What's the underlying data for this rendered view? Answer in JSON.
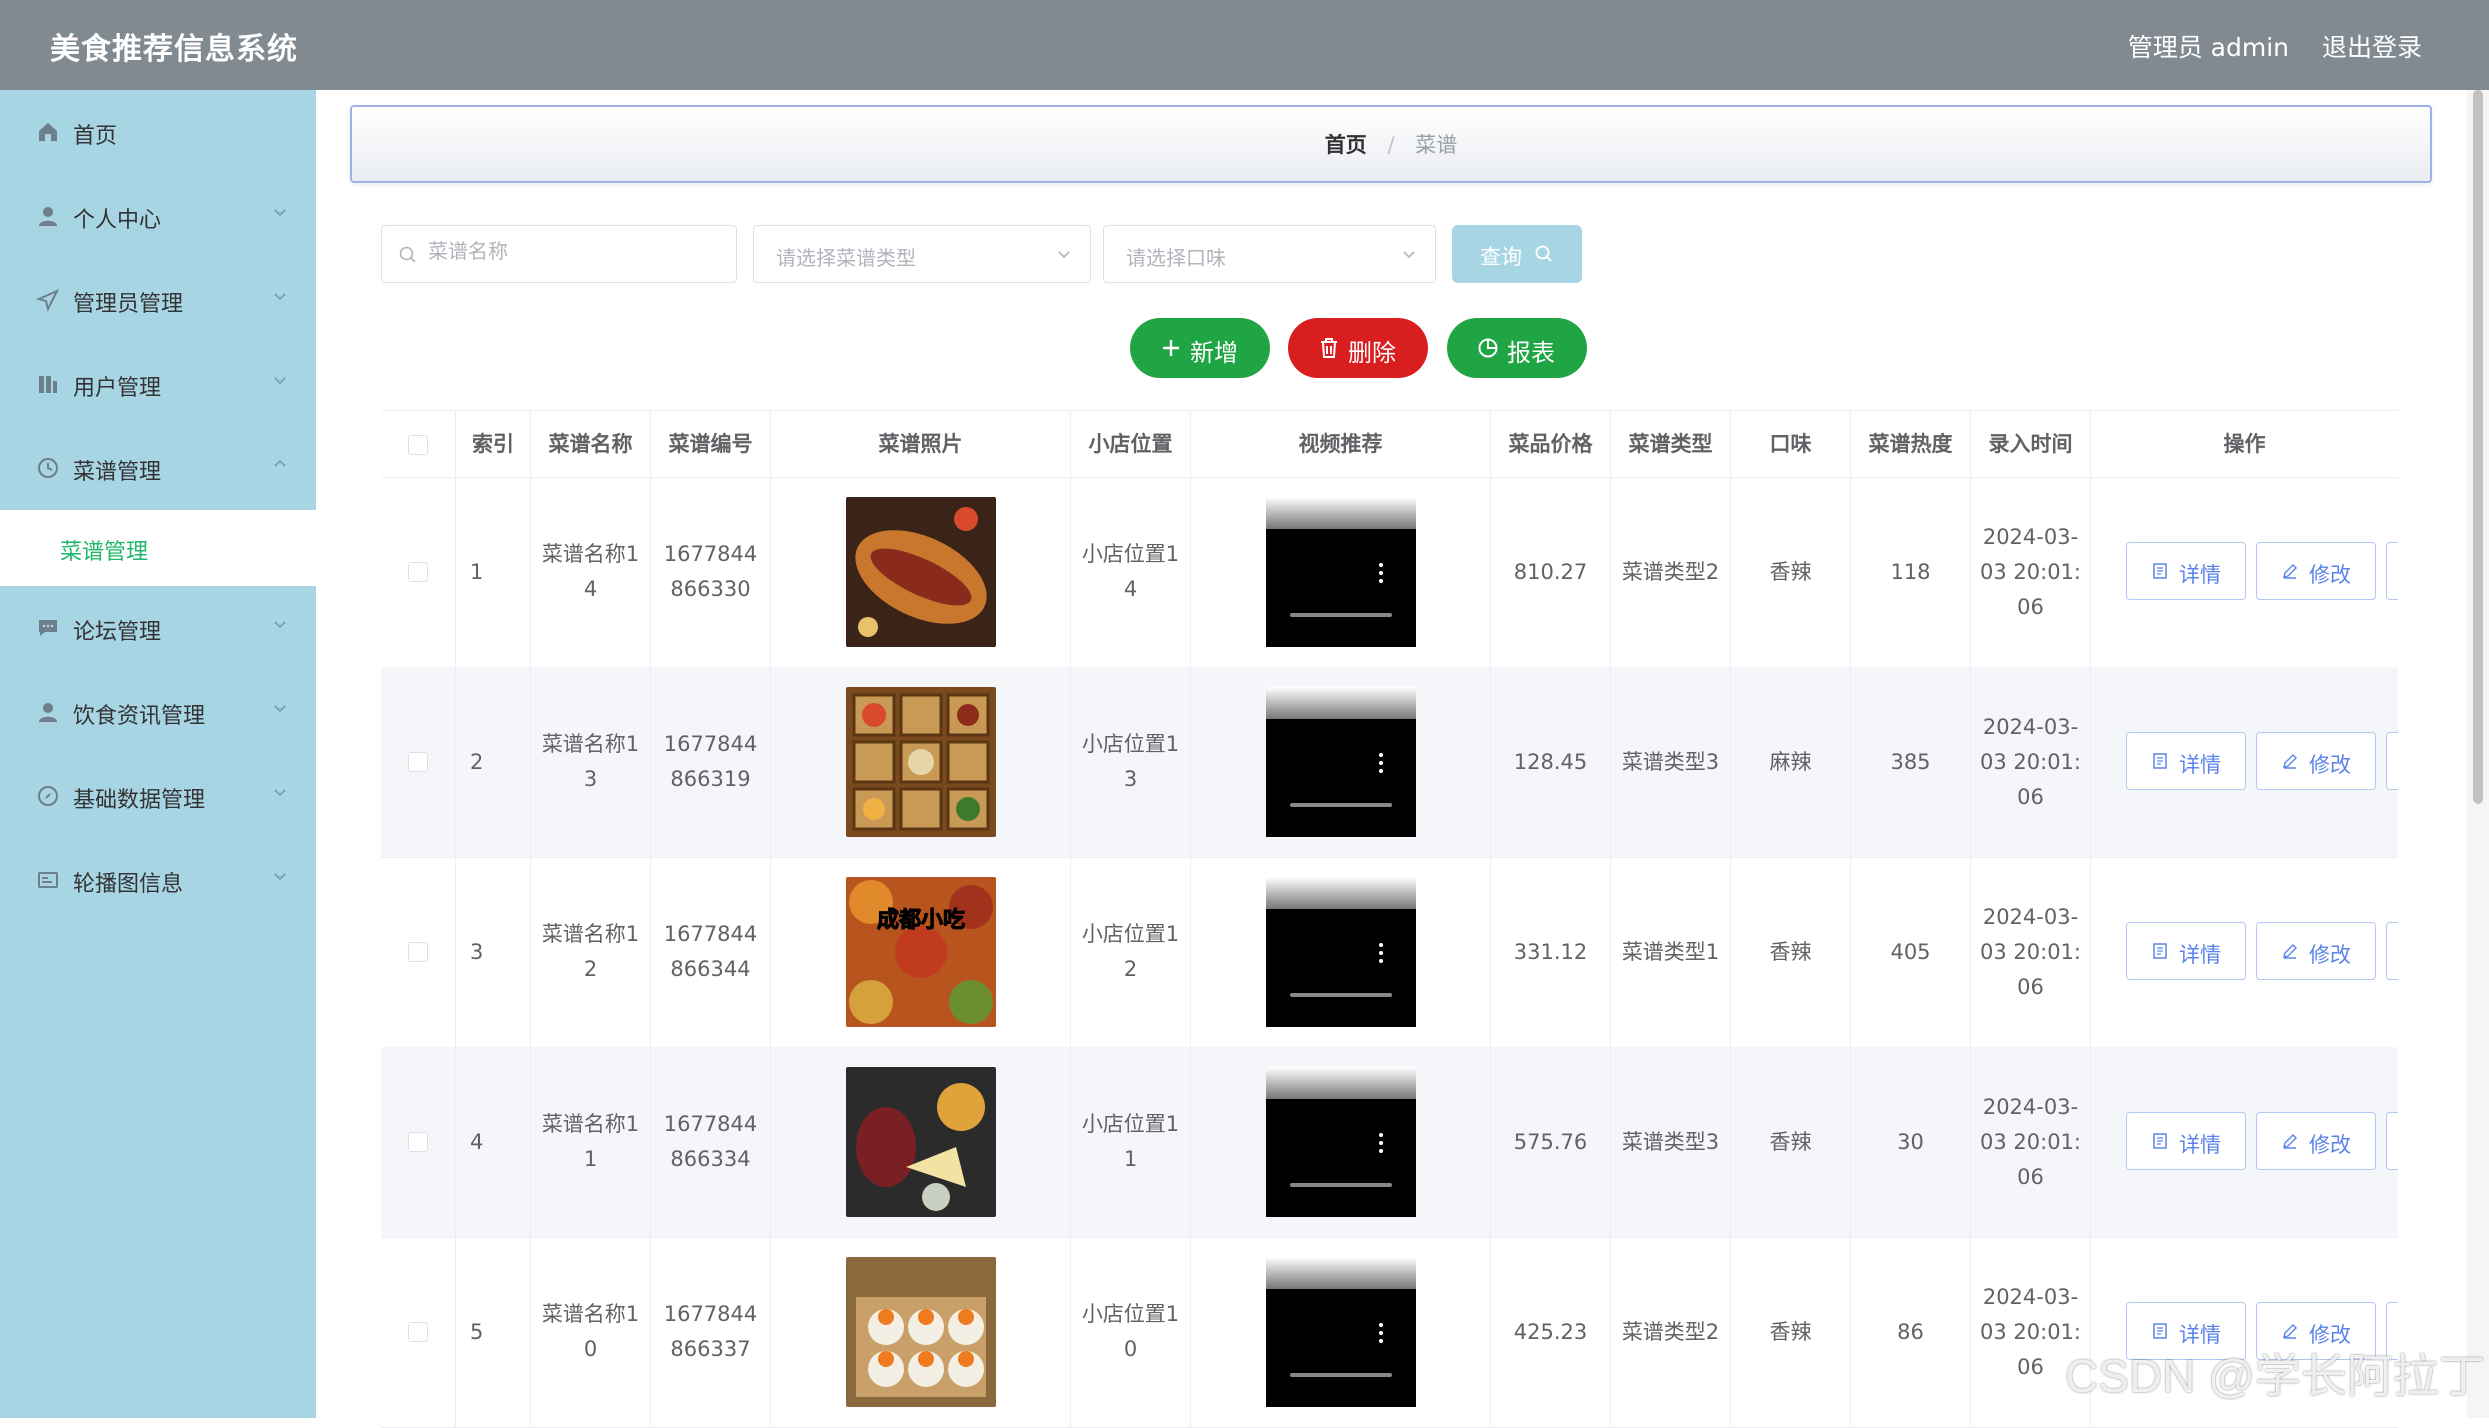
{
  "header": {
    "title": "美食推荐信息系统",
    "user": "管理员 admin",
    "logout": "退出登录"
  },
  "sidebar": {
    "items": [
      {
        "label": "首页",
        "icon": "home-icon"
      },
      {
        "label": "个人中心",
        "icon": "user-icon"
      },
      {
        "label": "管理员管理",
        "icon": "send-icon"
      },
      {
        "label": "用户管理",
        "icon": "chart-icon"
      },
      {
        "label": "菜谱管理",
        "icon": "clock-icon"
      },
      {
        "label": "论坛管理",
        "icon": "chat-icon"
      },
      {
        "label": "饮食资讯管理",
        "icon": "user-icon"
      },
      {
        "label": "基础数据管理",
        "icon": "compass-icon"
      },
      {
        "label": "轮播图信息",
        "icon": "card-icon"
      }
    ],
    "submenu": {
      "label": "菜谱管理"
    }
  },
  "breadcrumb": {
    "home": "首页",
    "separator": "/",
    "current": "菜谱"
  },
  "search": {
    "name_placeholder": "菜谱名称",
    "type_placeholder": "请选择菜谱类型",
    "taste_placeholder": "请选择口味",
    "query_label": "查询"
  },
  "actions": {
    "add": "新增",
    "delete": "删除",
    "report": "报表"
  },
  "colors": {
    "header": "#808a90",
    "sidebar": "#a8d5e4",
    "add": "#1fa543",
    "delete": "#d81e1e",
    "report": "#1fa543",
    "active_sub": "#1fb86a"
  },
  "table": {
    "headers": [
      "索引",
      "菜谱名称",
      "菜谱编号",
      "菜谱照片",
      "小店位置",
      "视频推荐",
      "菜品价格",
      "菜谱类型",
      "口味",
      "菜谱热度",
      "录入时间",
      "操作"
    ],
    "detail_label": "详情",
    "edit_label": "修改",
    "rows": [
      {
        "index": "1",
        "name": "菜谱名称14",
        "code": "1677844866330",
        "location": "小店位置14",
        "price": "810.27",
        "type": "菜谱类型2",
        "taste": "香辣",
        "heat": "118",
        "time": "2024-03-03 20:01:06"
      },
      {
        "index": "2",
        "name": "菜谱名称13",
        "code": "1677844866319",
        "location": "小店位置13",
        "price": "128.45",
        "type": "菜谱类型3",
        "taste": "麻辣",
        "heat": "385",
        "time": "2024-03-03 20:01:06"
      },
      {
        "index": "3",
        "name": "菜谱名称12",
        "code": "1677844866344",
        "location": "小店位置12",
        "price": "331.12",
        "type": "菜谱类型1",
        "taste": "香辣",
        "heat": "405",
        "time": "2024-03-03 20:01:06"
      },
      {
        "index": "4",
        "name": "菜谱名称11",
        "code": "1677844866334",
        "location": "小店位置11",
        "price": "575.76",
        "type": "菜谱类型3",
        "taste": "香辣",
        "heat": "30",
        "time": "2024-03-03 20:01:06"
      },
      {
        "index": "5",
        "name": "菜谱名称10",
        "code": "1677844866337",
        "location": "小店位置10",
        "price": "425.23",
        "type": "菜谱类型2",
        "taste": "香辣",
        "heat": "86",
        "time": "2024-03-03 20:01:06"
      }
    ]
  },
  "photo3_text": "成都小吃",
  "watermark": "CSDN @学长阿拉丁"
}
